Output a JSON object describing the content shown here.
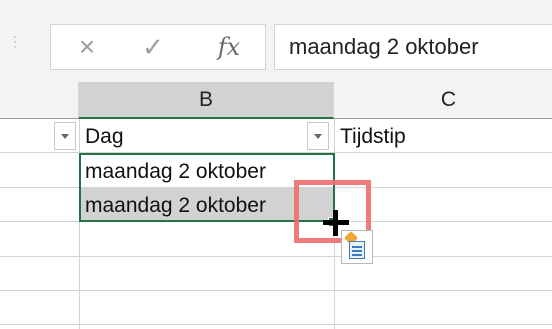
{
  "formula_bar": {
    "cancel_icon": "×",
    "enter_icon": "✓",
    "function_label": "fx",
    "value": "maandag 2 oktober"
  },
  "columns": {
    "b": "B",
    "c": "C"
  },
  "cells": {
    "b_header": "Dag",
    "c_header": "Tijdstip",
    "b_row2": "maandag 2 oktober",
    "b_row3": "maandag 2 oktober"
  },
  "colors": {
    "selection": "#217346",
    "highlight": "#ef6b6b"
  },
  "icons": [
    "drag-grip-icon",
    "cancel-icon",
    "enter-icon",
    "function-icon",
    "filter-dropdown-icon",
    "crosshair-cursor-icon",
    "autofill-options-icon"
  ]
}
